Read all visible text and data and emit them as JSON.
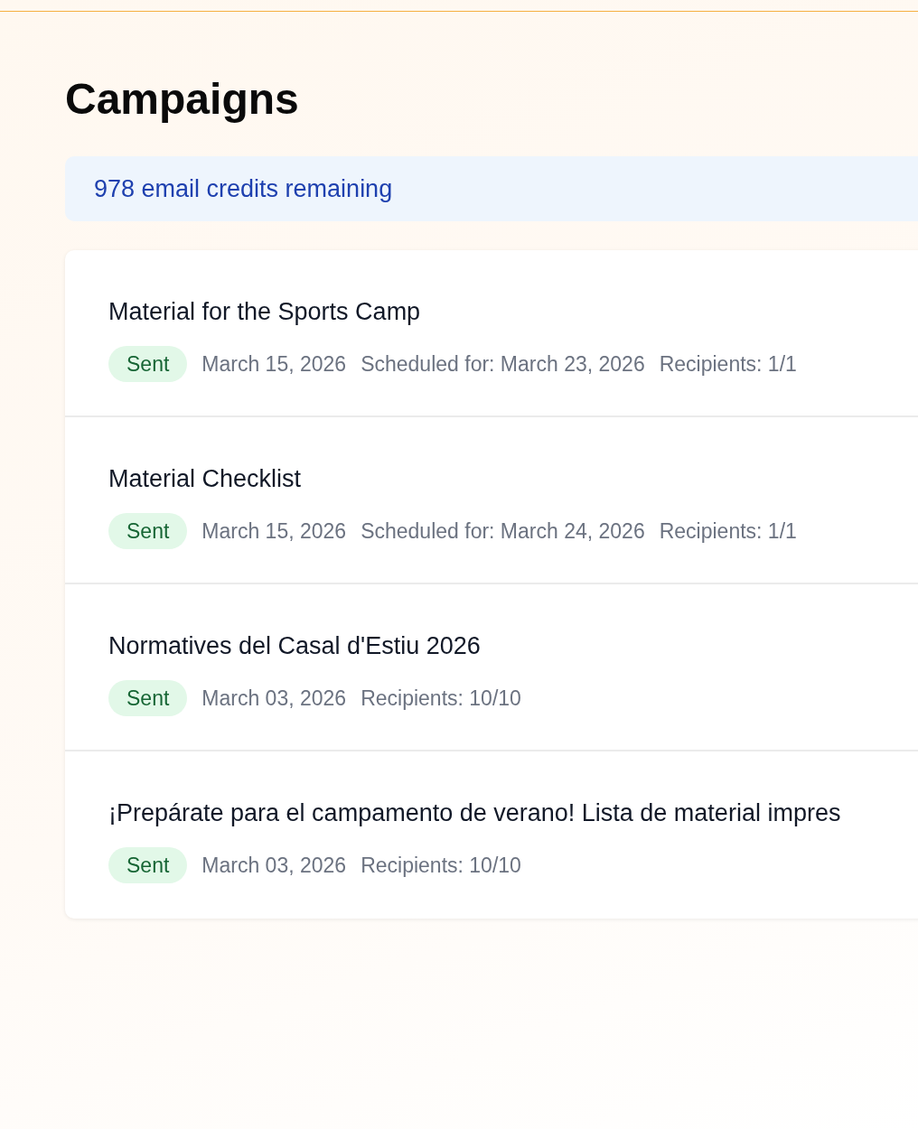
{
  "title": "Campaigns",
  "credits_banner": "978 email credits remaining",
  "campaigns": [
    {
      "name": "Material for the Sports Camp",
      "status": {
        "kind": "sent",
        "label": "Sent"
      },
      "meta": [
        "March 15, 2026",
        "Scheduled for: March 23, 2026",
        "Recipients: 1/1"
      ]
    },
    {
      "name": "Material Checklist",
      "status": {
        "kind": "sent",
        "label": "Sent"
      },
      "meta": [
        "March 15, 2026",
        "Scheduled for: March 24, 2026",
        "Recipients: 1/1"
      ]
    },
    {
      "name": "Normatives del Casal d'Estiu 2026",
      "status": {
        "kind": "sent",
        "label": "Sent"
      },
      "meta": [
        "March 03, 2026",
        "Recipients: 10/10"
      ]
    },
    {
      "name": "¡Prepárate para el campamento de verano! Lista de material impres",
      "status": {
        "kind": "sent",
        "label": "Sent"
      },
      "meta": [
        "March 03, 2026",
        "Recipients: 10/10"
      ]
    }
  ]
}
